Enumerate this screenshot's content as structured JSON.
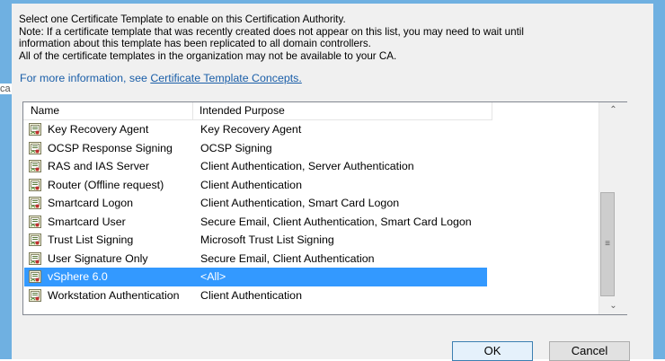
{
  "dialog": {
    "description_lines": [
      "Select one Certificate Template to enable on this Certification Authority.",
      "Note: If a certificate template that was recently created does not appear on this list, you may need to wait until",
      "information about this template has been replicated to all domain controllers.",
      "All of the certificate templates in the organization may not be available to your CA."
    ],
    "more_info_prefix": "For more information, see ",
    "more_info_link": "Certificate Template Concepts.",
    "background_peek": "ca"
  },
  "list": {
    "columns": {
      "name": "Name",
      "purpose": "Intended Purpose"
    },
    "rows": [
      {
        "name": "Key Recovery Agent",
        "purpose": "Key Recovery Agent"
      },
      {
        "name": "OCSP Response Signing",
        "purpose": "OCSP Signing"
      },
      {
        "name": "RAS and IAS Server",
        "purpose": "Client Authentication, Server Authentication"
      },
      {
        "name": "Router (Offline request)",
        "purpose": "Client Authentication"
      },
      {
        "name": "Smartcard Logon",
        "purpose": "Client Authentication, Smart Card Logon"
      },
      {
        "name": "Smartcard User",
        "purpose": "Secure Email, Client Authentication, Smart Card Logon"
      },
      {
        "name": "Trust List Signing",
        "purpose": "Microsoft Trust List Signing"
      },
      {
        "name": "User Signature Only",
        "purpose": "Secure Email, Client Authentication"
      },
      {
        "name": "vSphere 6.0",
        "purpose": "<All>"
      },
      {
        "name": "Workstation Authentication",
        "purpose": "Client Authentication"
      }
    ],
    "selected_index": 8
  },
  "buttons": {
    "ok": "OK",
    "cancel": "Cancel"
  },
  "icons": {
    "row_icon": "certificate-template-icon",
    "scroll_up": "chevron-up-icon",
    "scroll_down": "chevron-down-icon",
    "scroll_grip": "scroll-grip-icon"
  },
  "colors": {
    "frame": "#6fb0e1",
    "selection": "#3399ff",
    "link": "#1a5ea8"
  }
}
